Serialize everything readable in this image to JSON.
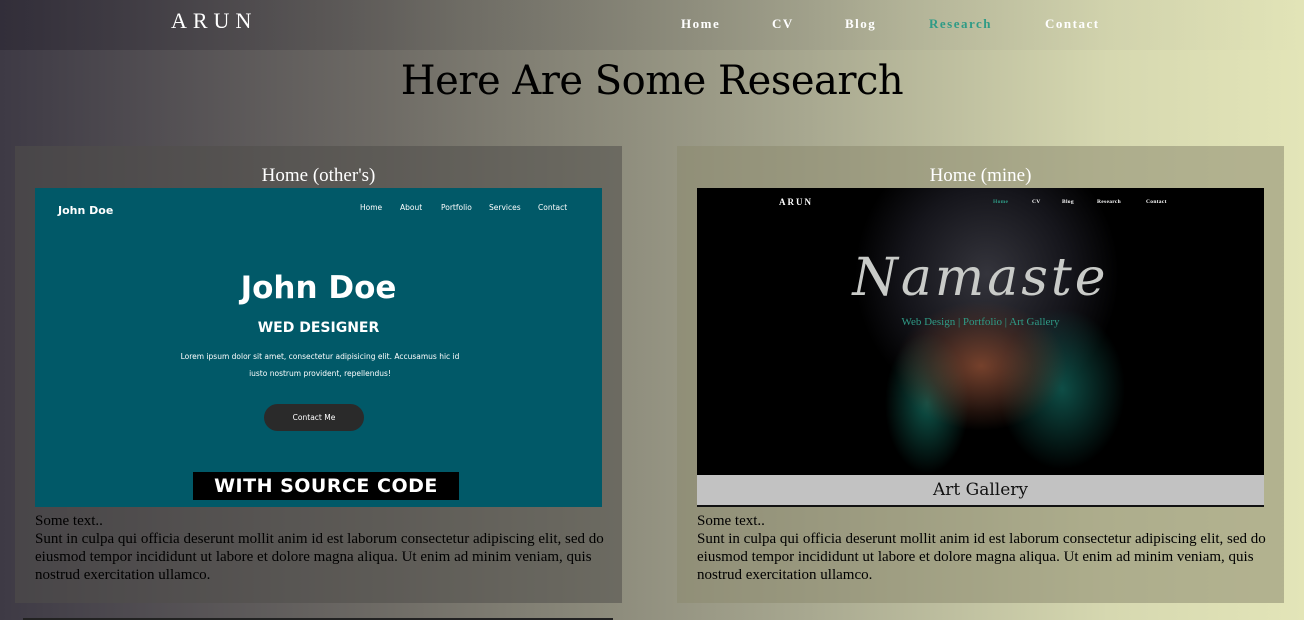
{
  "nav": {
    "brand": "ARUN",
    "links": [
      {
        "label": "Home",
        "active": false
      },
      {
        "label": "CV",
        "active": false
      },
      {
        "label": "Blog",
        "active": false
      },
      {
        "label": "Research",
        "active": true
      },
      {
        "label": "Contact",
        "active": false
      }
    ]
  },
  "page_title": "Here Are Some Research",
  "cards": [
    {
      "title": "Home (other's)",
      "screenshot": {
        "logo": "John Doe",
        "nav": [
          "Home",
          "About",
          "Portfolio",
          "Services",
          "Contact"
        ],
        "name": "John Doe",
        "role": "WED DESIGNER",
        "lorem": "Lorem ipsum dolor sit amet, consectetur adipisicing elit. Accusamus hic id iusto nostrum provident, repellendus!",
        "button": "Contact Me",
        "banner": "WITH SOURCE CODE"
      },
      "text_head": "Some text..",
      "text_body": "Sunt in culpa qui officia deserunt mollit anim id est laborum consectetur adipiscing elit, sed do eiusmod tempor incididunt ut labore et dolore magna aliqua. Ut enim ad minim veniam, quis nostrud exercitation ullamco."
    },
    {
      "title": "Home (mine)",
      "screenshot": {
        "logo": "ARUN",
        "nav": [
          "Home",
          "CV",
          "Blog",
          "Research",
          "Contact"
        ],
        "title": "Namaste",
        "subtitle": "Web Design | Portfolio | Art Gallery",
        "band": "Art Gallery"
      },
      "text_head": "Some text..",
      "text_body": "Sunt in culpa qui officia deserunt mollit anim id est laborum consectetur adipiscing elit, sed do eiusmod tempor incididunt ut labore et dolore magna aliqua. Ut enim ad minim veniam, quis nostrud exercitation ullamco."
    }
  ],
  "colors": {
    "accent": "#2f9b86",
    "left_shot_bg": "#015968"
  }
}
